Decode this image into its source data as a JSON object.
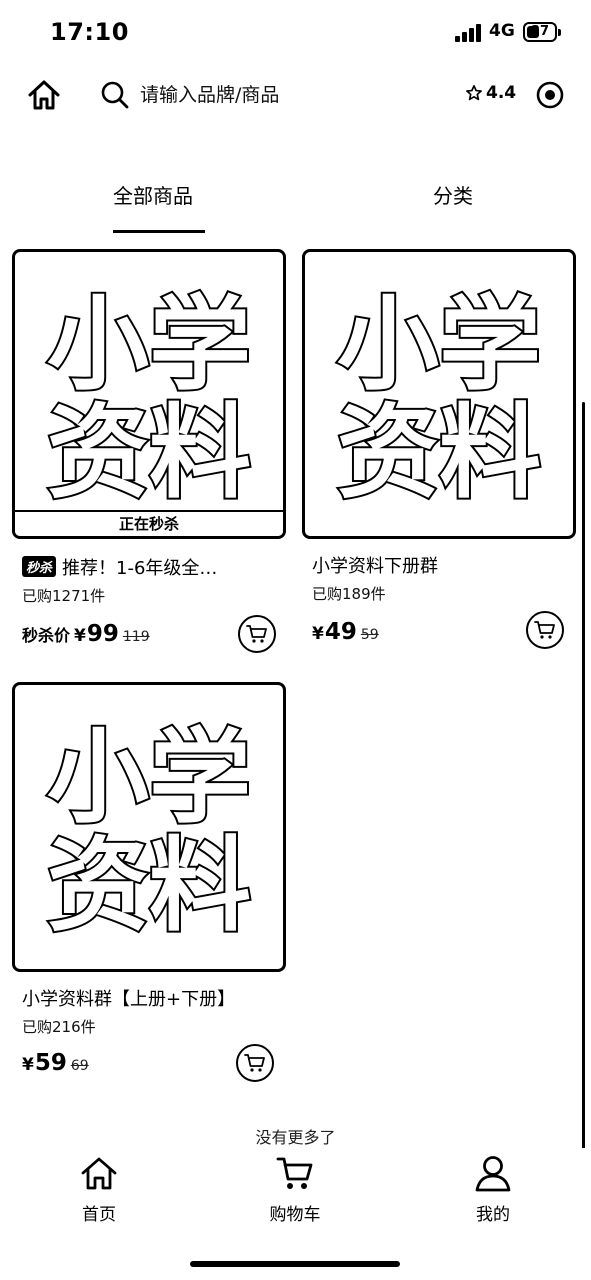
{
  "status_bar": {
    "time": "17:10",
    "network": "4G",
    "battery": "37"
  },
  "top_nav": {
    "search_placeholder": "请输入品牌/商品",
    "rating": "4.4",
    "icons": [
      "home-icon",
      "search-icon",
      "star-icon",
      "target-icon"
    ]
  },
  "tabs": [
    {
      "label": "全部商品",
      "active": true
    },
    {
      "label": "分类",
      "active": false
    }
  ],
  "products": [
    {
      "image_text": [
        "小学",
        "资料"
      ],
      "flash_banner": "正在秒杀",
      "tag": "秒杀",
      "title": "推荐！1-6年级全…",
      "sold": "已购1271件",
      "price_label": "秒杀价",
      "currency": "¥",
      "price": "99",
      "original_price": "119"
    },
    {
      "image_text": [
        "小学",
        "资料"
      ],
      "title": "小学资料下册群",
      "sold": "已购189件",
      "currency": "¥",
      "price": "49",
      "original_price": "59"
    },
    {
      "image_text": [
        "小学",
        "资料"
      ],
      "title": "小学资料群【上册+下册】",
      "sold": "已购216件",
      "currency": "¥",
      "price": "59",
      "original_price": "69"
    }
  ],
  "footer_note": "没有更多了",
  "tab_bar": [
    {
      "label": "首页",
      "icon": "home-icon"
    },
    {
      "label": "购物车",
      "icon": "cart-icon"
    },
    {
      "label": "我的",
      "icon": "user-icon"
    }
  ]
}
